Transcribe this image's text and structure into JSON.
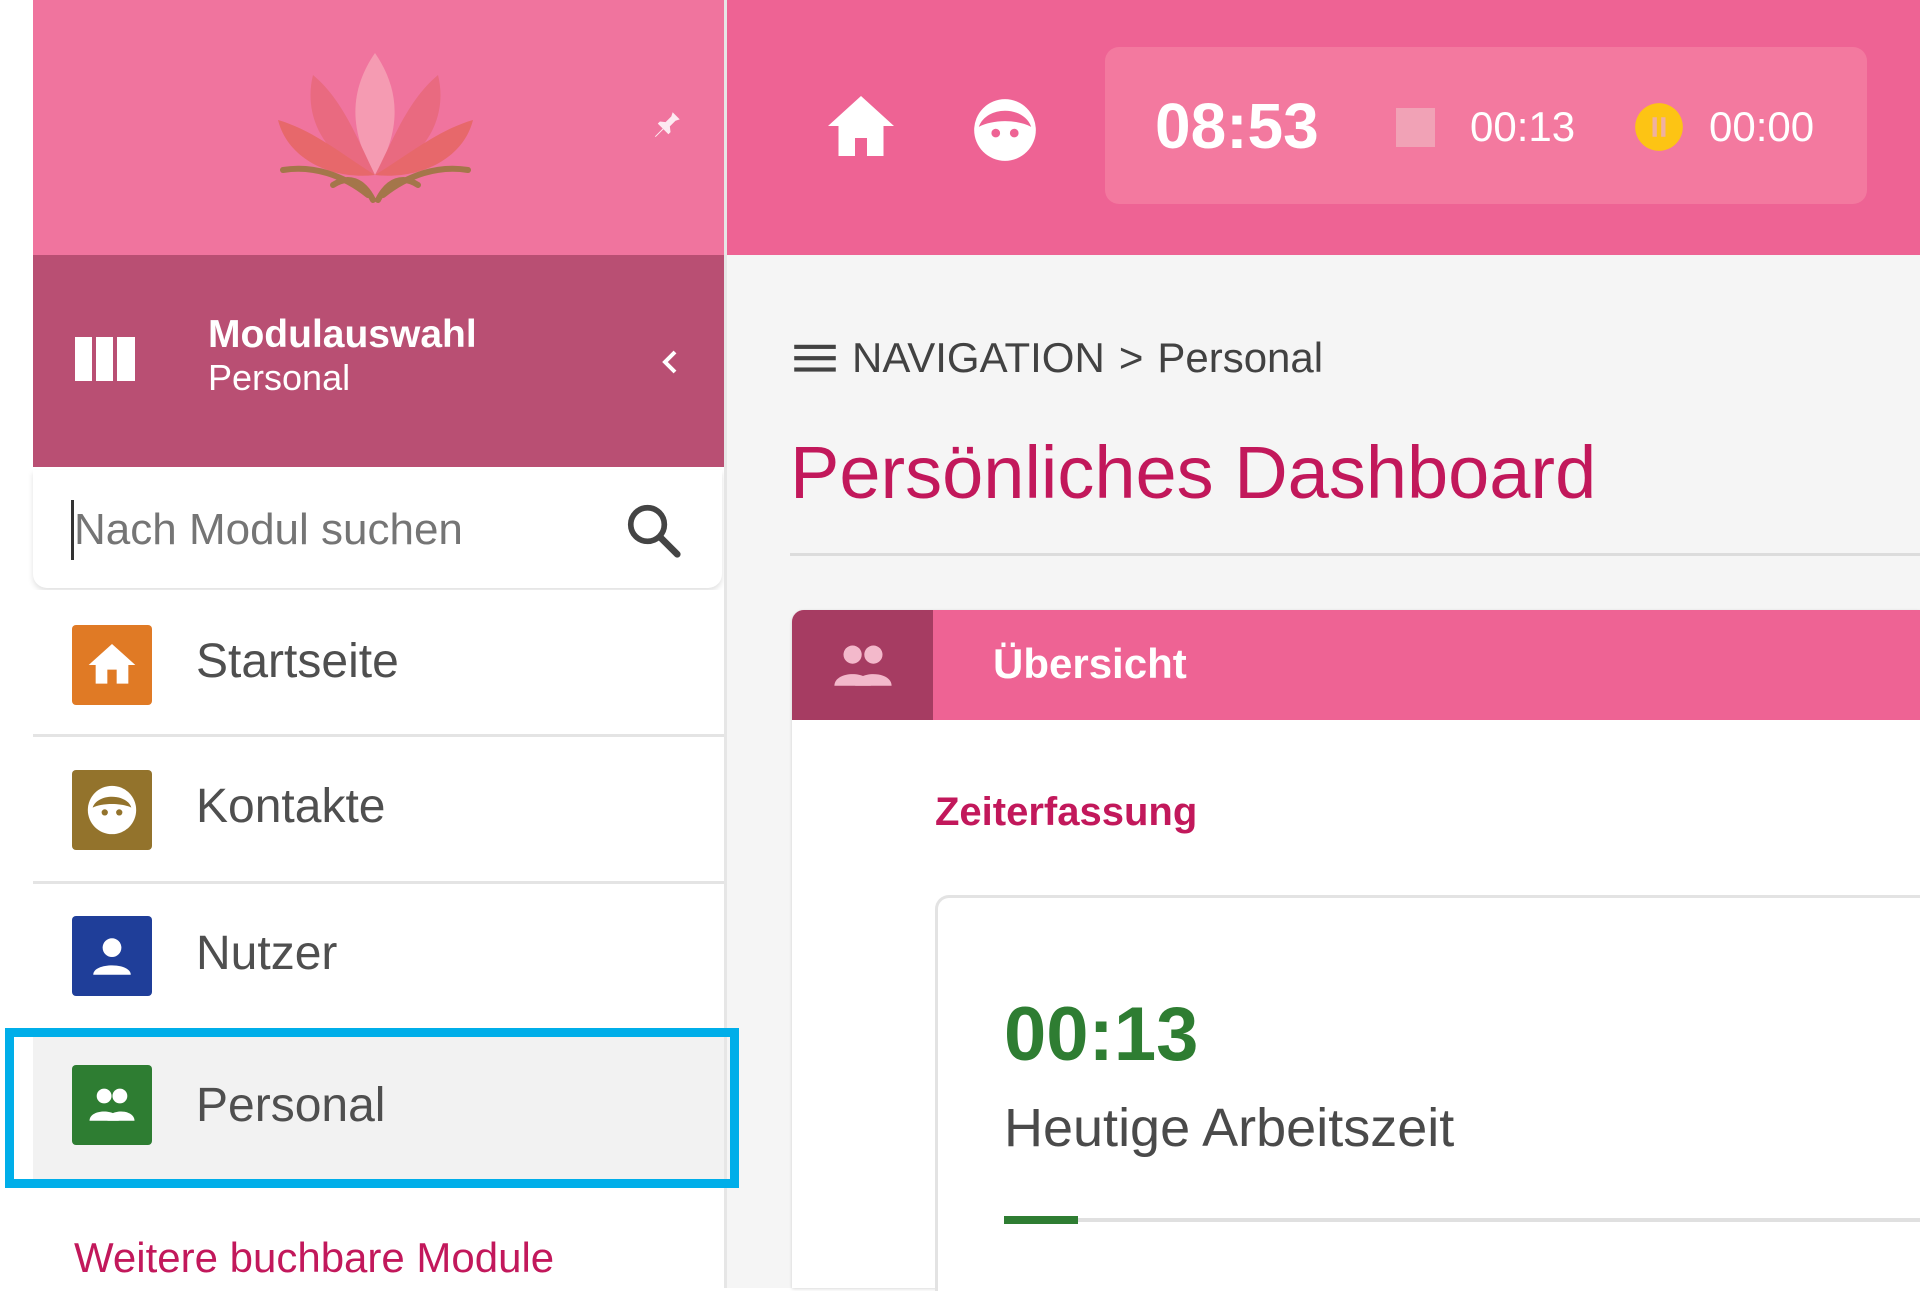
{
  "sidebar": {
    "module_header": {
      "title": "Modulauswahl",
      "subtitle": "Personal"
    },
    "search": {
      "placeholder": "Nach Modul suchen"
    },
    "items": [
      {
        "label": "Startseite",
        "icon": "home-icon",
        "color": "#e07a25"
      },
      {
        "label": "Kontakte",
        "icon": "face-icon",
        "color": "#93732c"
      },
      {
        "label": "Nutzer",
        "icon": "person-icon",
        "color": "#1f3e99"
      },
      {
        "label": "Personal",
        "icon": "people-icon",
        "color": "#2e7d32",
        "selected": true
      }
    ],
    "more_modules_label": "Weitere buchbare Module"
  },
  "topbar": {
    "clock": "08:53",
    "work_timer": "00:13",
    "pause_timer": "00:00"
  },
  "breadcrumb": {
    "root": "NAVIGATION",
    "separator": ">",
    "current": "Personal"
  },
  "page_title": "Persönliches Dashboard",
  "card": {
    "tab_label": "Übersicht",
    "section_title": "Zeiterfassung",
    "work_time_value": "00:13",
    "work_time_label": "Heutige Arbeitszeit"
  },
  "colors": {
    "brand_pink": "#ee6394",
    "sidebar_header": "#b94f73",
    "accent_text": "#c2185b",
    "success_green": "#2e7d32",
    "pause_yellow": "#fdc414",
    "highlight_blue": "#00aee9"
  }
}
